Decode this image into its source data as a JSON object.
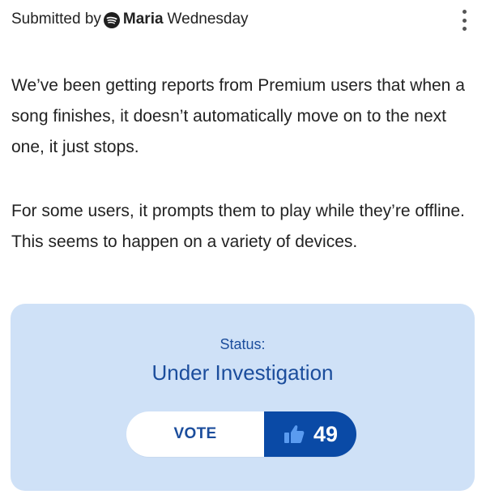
{
  "header": {
    "submitted_label": "Submitted by",
    "brand_icon": "spotify-icon",
    "author": "Maria",
    "day": "Wednesday",
    "menu_icon": "more-vertical-icon"
  },
  "post": {
    "paragraph_1": "We’ve been getting reports from Premium users that when a song finishes, it doesn’t automatically move on to the next one, it just stops.",
    "paragraph_2": "For some users, it prompts them to play while they’re offline. This seems to happen on a variety of devices."
  },
  "status": {
    "label": "Status:",
    "value": "Under Investigation"
  },
  "vote": {
    "button_label": "VOTE",
    "count": "49",
    "icon": "thumbs-up-icon"
  },
  "colors": {
    "accent": "#0a4aa6",
    "status_card_bg": "#cfe1f7",
    "status_text": "#1b4d9c"
  }
}
